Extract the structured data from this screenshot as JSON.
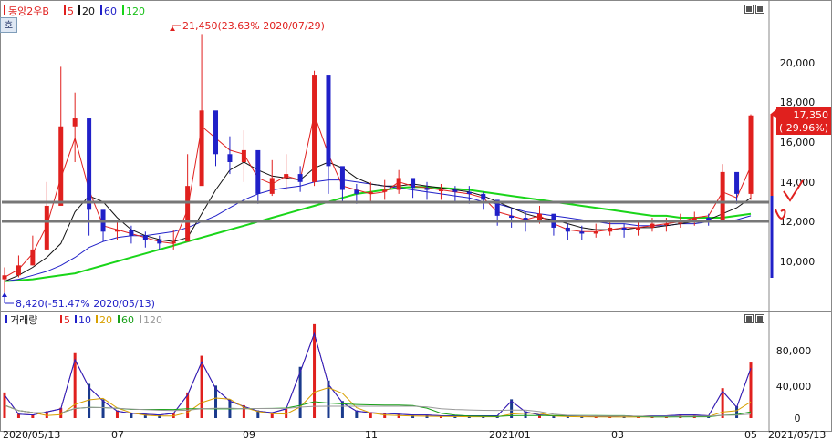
{
  "price_panel": {
    "stock_name": "동양2우B",
    "ma_labels": [
      "5",
      "20",
      "60",
      "120"
    ],
    "ma_colors": [
      "#e0201e",
      "#111111",
      "#2020c8",
      "#19d519"
    ],
    "max_annotation": "21,450(23.63% 2020/07/29)",
    "min_annotation": "8,420(-51.47% 2020/05/13)",
    "last_price": "17,350",
    "last_change": "( 29.96%)",
    "y_ticks": [
      "20,000",
      "18,000",
      "16,000",
      "14,000",
      "12,000",
      "10,000"
    ],
    "side_button": "호"
  },
  "volume_panel": {
    "label": "거래량",
    "ma_labels": [
      "5",
      "10",
      "20",
      "60",
      "120"
    ],
    "ma_colors": [
      "#e0201e",
      "#2020c8",
      "#d8a000",
      "#19a019",
      "#999999"
    ],
    "y_ticks": [
      "80,000",
      "40,000",
      "0"
    ]
  },
  "x_axis": {
    "labels": [
      "2020/05/13",
      "07",
      "09",
      "11",
      "2021/01",
      "03",
      "05",
      "2021/05/13"
    ]
  },
  "chart_data": [
    {
      "type": "candlestick",
      "title": "동양2우B",
      "y_ticks": [
        10000,
        12000,
        14000,
        16000,
        18000,
        20000
      ],
      "ylim": [
        8000,
        22600
      ],
      "x_start": "2020/05/13",
      "x_end": "2021/05/13",
      "series": [
        {
          "name": "5",
          "values": [
            9200,
            9600,
            10400,
            11800,
            14200,
            16200,
            13600,
            11800,
            11600,
            11400,
            11200,
            11000,
            10900,
            12600,
            16800,
            16200,
            15600,
            15400,
            14200,
            13900,
            14300,
            14100,
            17400,
            15400,
            13800,
            13600,
            13400,
            13500,
            14000,
            13800,
            13700,
            13600,
            13500,
            13400,
            13200,
            12500,
            12300,
            12100,
            12300,
            11900,
            11600,
            11500,
            11500,
            11600,
            11700,
            11700,
            11800,
            11900,
            12000,
            12200,
            12300,
            13500,
            13200,
            14800
          ]
        },
        {
          "name": "20",
          "values": [
            9000,
            9300,
            9700,
            10200,
            10900,
            12500,
            13300,
            13000,
            12200,
            11600,
            11300,
            11100,
            11000,
            11200,
            12400,
            13600,
            14600,
            15000,
            14600,
            14300,
            14200,
            14100,
            14700,
            15000,
            14700,
            14200,
            13900,
            13800,
            13800,
            13900,
            13800,
            13700,
            13600,
            13500,
            13300,
            13000,
            12700,
            12400,
            12200,
            12100,
            11900,
            11700,
            11600,
            11600,
            11600,
            11700,
            11700,
            11800,
            11900,
            12000,
            12100,
            12400,
            12700,
            13200
          ]
        },
        {
          "name": "60",
          "values": [
            9000,
            9100,
            9300,
            9500,
            9800,
            10200,
            10700,
            11000,
            11200,
            11300,
            11300,
            11400,
            11500,
            11700,
            12000,
            12300,
            12700,
            13100,
            13400,
            13600,
            13700,
            13800,
            14000,
            14100,
            14100,
            14000,
            13900,
            13800,
            13700,
            13600,
            13500,
            13400,
            13300,
            13200,
            13000,
            12900,
            12700,
            12500,
            12400,
            12300,
            12200,
            12100,
            12000,
            11900,
            11900,
            11800,
            11800,
            11800,
            11900,
            11900,
            12000,
            12000,
            12100,
            12300
          ]
        },
        {
          "name": "120",
          "values": [
            9000,
            9050,
            9100,
            9200,
            9300,
            9400,
            9600,
            9800,
            10000,
            10200,
            10400,
            10600,
            10800,
            11000,
            11200,
            11400,
            11600,
            11800,
            12000,
            12200,
            12400,
            12600,
            12800,
            13000,
            13200,
            13400,
            13500,
            13600,
            13700,
            13750,
            13750,
            13700,
            13650,
            13600,
            13500,
            13400,
            13300,
            13200,
            13100,
            13000,
            12900,
            12800,
            12700,
            12600,
            12500,
            12400,
            12300,
            12300,
            12200,
            12200,
            12200,
            12200,
            12300,
            12400
          ]
        }
      ],
      "close": [
        9300,
        9800,
        10600,
        12800,
        16800,
        17200,
        12600,
        11500,
        11600,
        11300,
        11100,
        10900,
        11000,
        13800,
        17600,
        15400,
        15000,
        15600,
        13400,
        14200,
        14400,
        14000,
        19400,
        14800,
        13600,
        13400,
        13500,
        13600,
        14200,
        13700,
        13600,
        13600,
        13500,
        13400,
        13100,
        12300,
        12200,
        12000,
        12400,
        11700,
        11500,
        11400,
        11500,
        11700,
        11600,
        11700,
        11900,
        11900,
        12100,
        12200,
        12100,
        14500,
        13400,
        17350
      ],
      "high": [
        9700,
        10300,
        11300,
        14000,
        19800,
        18500,
        14300,
        12300,
        12000,
        11800,
        11500,
        11300,
        11600,
        15400,
        21450,
        17400,
        16300,
        16600,
        14500,
        15100,
        15400,
        14800,
        19600,
        16400,
        14300,
        13900,
        14000,
        14100,
        14600,
        14100,
        14000,
        13900,
        13800,
        13800,
        13500,
        12900,
        12700,
        12500,
        12800,
        12100,
        11900,
        11800,
        11900,
        12000,
        11900,
        12000,
        12200,
        12200,
        12400,
        12500,
        12400,
        14900,
        14400,
        17400
      ],
      "low": [
        8420,
        9200,
        9800,
        11000,
        13000,
        15000,
        11300,
        11000,
        11100,
        10900,
        10700,
        10600,
        10600,
        11500,
        15600,
        14800,
        14400,
        14000,
        12900,
        13300,
        13600,
        13500,
        13800,
        13400,
        13000,
        12900,
        13000,
        13100,
        13400,
        13200,
        13100,
        13100,
        13000,
        12900,
        12600,
        11800,
        11700,
        11500,
        11900,
        11300,
        11100,
        11100,
        11200,
        11300,
        11200,
        11300,
        11500,
        11500,
        11700,
        11800,
        11800,
        12400,
        12900,
        13100
      ],
      "max_point": {
        "value": 21450,
        "change_pct": 23.63,
        "date": "2020/07/29"
      },
      "min_point": {
        "value": 8420,
        "change_pct": -51.47,
        "date": "2020/05/13"
      },
      "last": {
        "value": 17350,
        "change_pct": 29.96
      }
    },
    {
      "type": "bar",
      "title": "거래량",
      "y_ticks": [
        0,
        40000,
        80000
      ],
      "ylim": [
        0,
        120000
      ],
      "values": [
        30000,
        5000,
        4000,
        8000,
        12000,
        76000,
        40000,
        22000,
        9000,
        6000,
        5000,
        4000,
        6000,
        30000,
        73000,
        38000,
        22000,
        15000,
        9000,
        7000,
        12000,
        60000,
        110000,
        44000,
        20000,
        9000,
        7000,
        6000,
        5000,
        4000,
        4000,
        3000,
        3000,
        3000,
        3000,
        3000,
        22000,
        8000,
        4000,
        3000,
        3000,
        3000,
        2000,
        2000,
        3000,
        2000,
        3000,
        3000,
        4000,
        4000,
        3000,
        35000,
        14000,
        65000
      ]
    }
  ]
}
